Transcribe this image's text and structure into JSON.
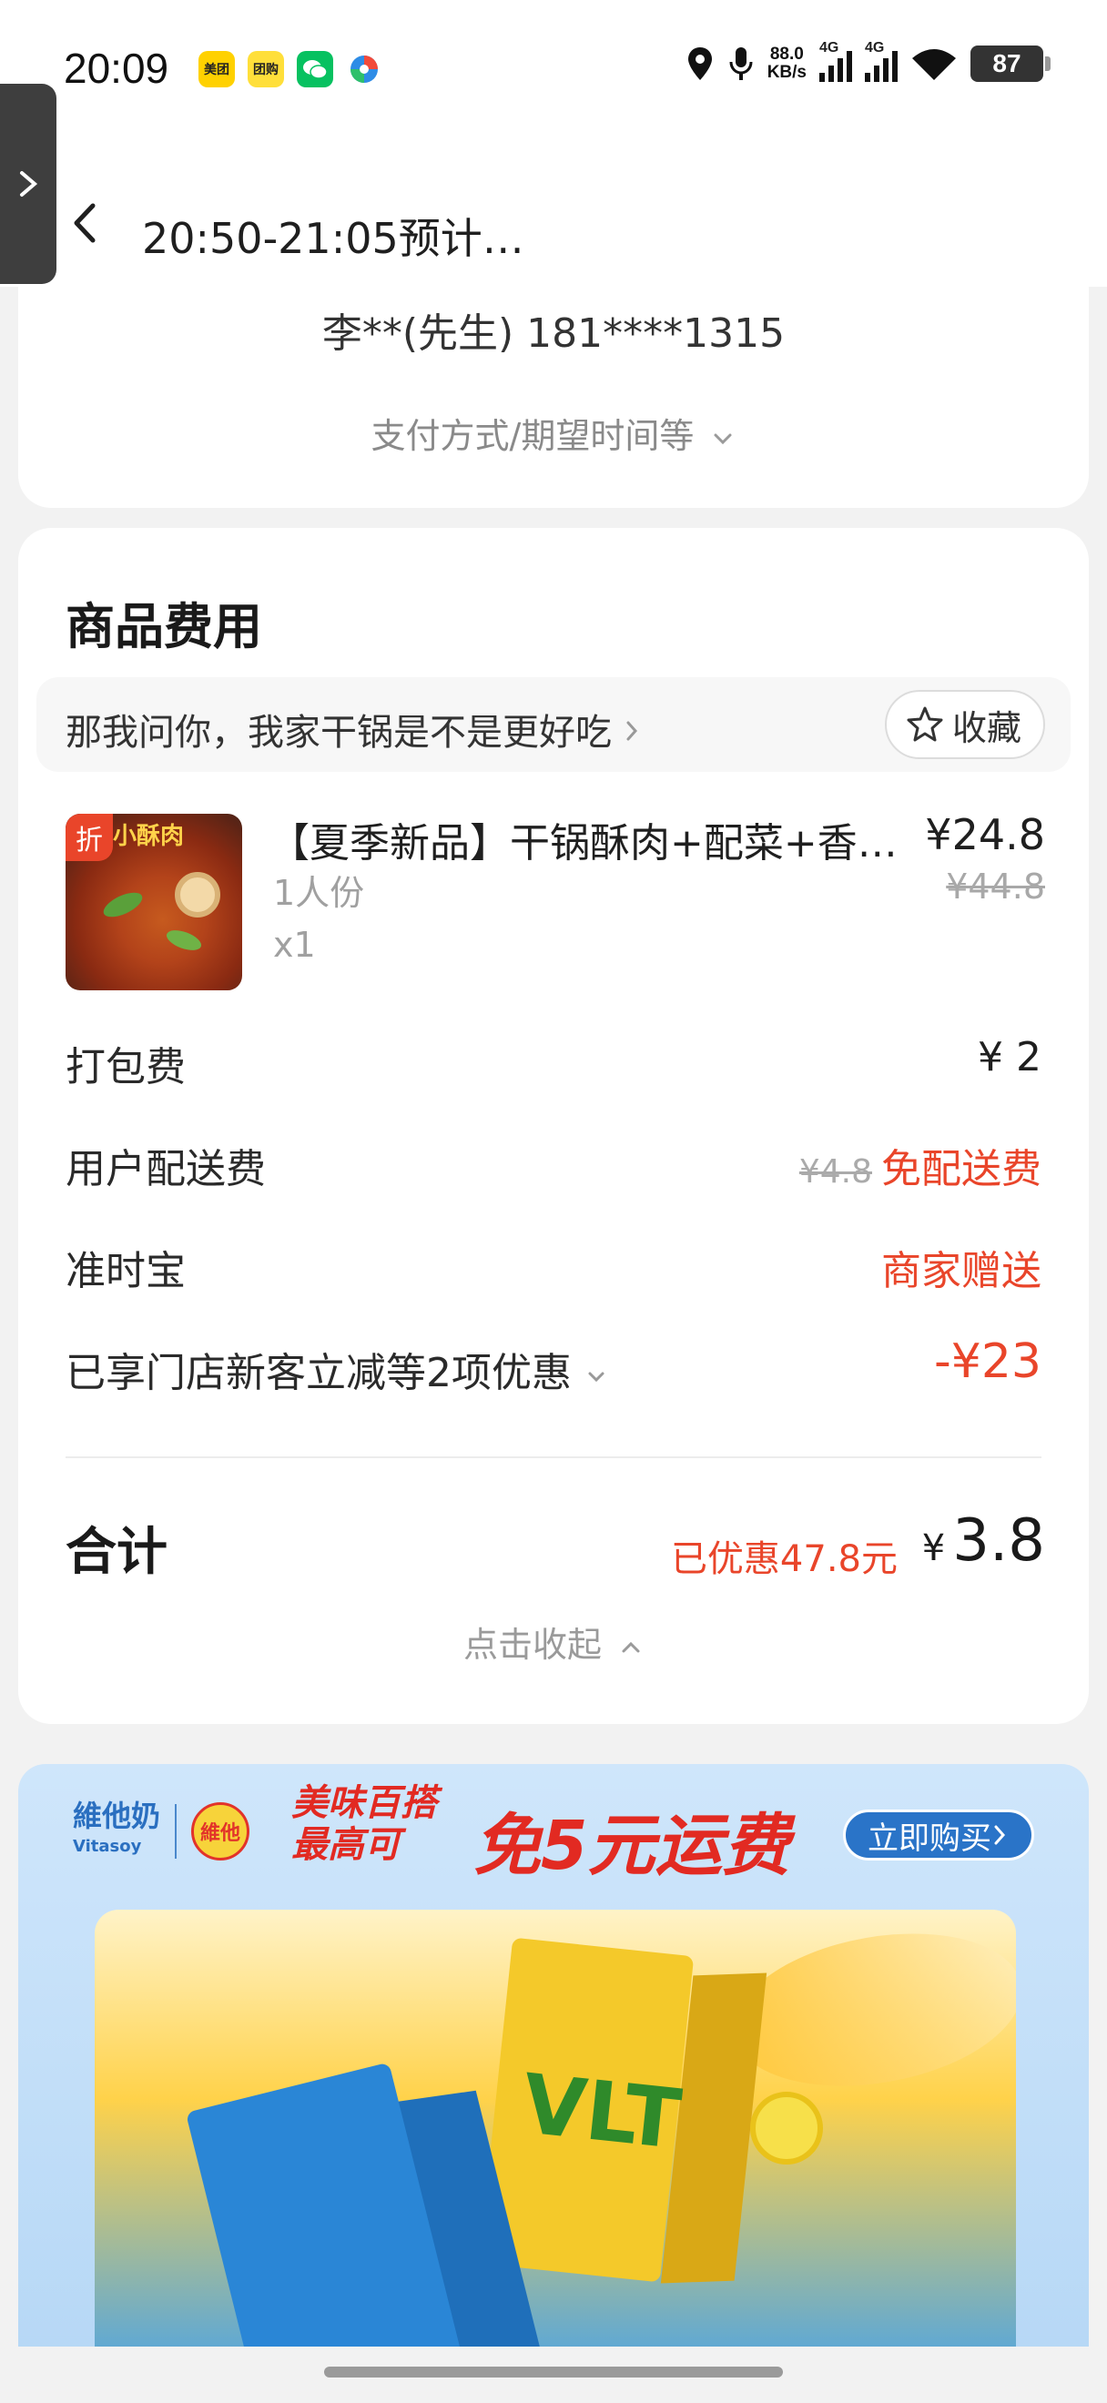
{
  "status_bar": {
    "time": "20:09",
    "apps": [
      {
        "name": "meituan-app-icon",
        "label": "美团",
        "color": "#ffd100"
      },
      {
        "name": "tuanhao-app-icon",
        "label": "团购",
        "color": "#ffdf3a"
      },
      {
        "name": "wechat-app-icon",
        "label": "",
        "color": "#07c160"
      },
      {
        "name": "pinwheel-app-icon",
        "label": "",
        "color": "#ffffff"
      }
    ],
    "net_speed": "88.0",
    "net_unit": "KB/s",
    "signal1": "4G",
    "signal2": "4G",
    "battery": "87"
  },
  "header": {
    "title": "20:50-21:05预计…"
  },
  "address": {
    "contact": "李**(先生) 181****1315",
    "more_toggle": "支付方式/期望时间等"
  },
  "goods": {
    "section_title": "商品费用",
    "store_name": "那我问你，我家干锅是不是更好吃",
    "favorite_label": "收藏",
    "item": {
      "name": "【夏季新品】干锅酥肉+配菜+香…",
      "spec": "1人份",
      "qty": "x1",
      "price": "¥24.8",
      "original_price": "¥44.8",
      "tag": "折",
      "image_banner": "小酥肉"
    },
    "fees": [
      {
        "label": "打包费",
        "value": "¥ 2"
      },
      {
        "label": "用户配送费",
        "strike": "¥4.8",
        "value": "免配送费"
      },
      {
        "label": "准时宝",
        "value": "商家赠送"
      },
      {
        "label": "已享门店新客立减等2项优惠",
        "value": "-¥23"
      }
    ],
    "total_label": "合计",
    "total_saved": "已优惠47.8元",
    "total_currency": "¥",
    "total_value": "3.8",
    "collapse_label": "点击收起"
  },
  "ad": {
    "brand_en": "Vitasoy",
    "brand_cn": "維他奶",
    "logo_text": "維他",
    "slogan_top": "美味百搭",
    "slogan_bottom": "最高可",
    "slogan_main": "免5元运费",
    "buy_label": "立即购买",
    "product_text": "VLT"
  },
  "colors": {
    "accent_red": "#e9452a",
    "card_bg": "#ffffff",
    "page_bg": "#f2f2f2"
  }
}
